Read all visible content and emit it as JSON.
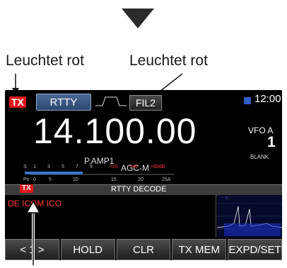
{
  "callouts": {
    "left": "Leuchtet rot",
    "right": "Leuchtet rot"
  },
  "screen": {
    "tx_badge": "TX",
    "mode": "RTTY",
    "filter": "FIL2",
    "clock": "12:00",
    "sd_icon": "sd-card-icon",
    "frequency": "14.100.00",
    "preamp": "P.AMP1",
    "agc": "AGC-M",
    "vfo": "VFO A",
    "vfo_number": "1",
    "blank": "BLANK",
    "decode": {
      "tx_badge": "TX",
      "title": "RTTY DECODE",
      "text": "DE ICOM ICO"
    },
    "buttons": [
      "< 1 >",
      "HOLD",
      "CLR",
      "TX MEM",
      "EXPD/SET"
    ]
  },
  "colors": {
    "tx_red": "#e0181d",
    "decode_text": "#ff3a3a",
    "mode_blue": "#2a4670",
    "meter_blue": "#3a72c8"
  }
}
